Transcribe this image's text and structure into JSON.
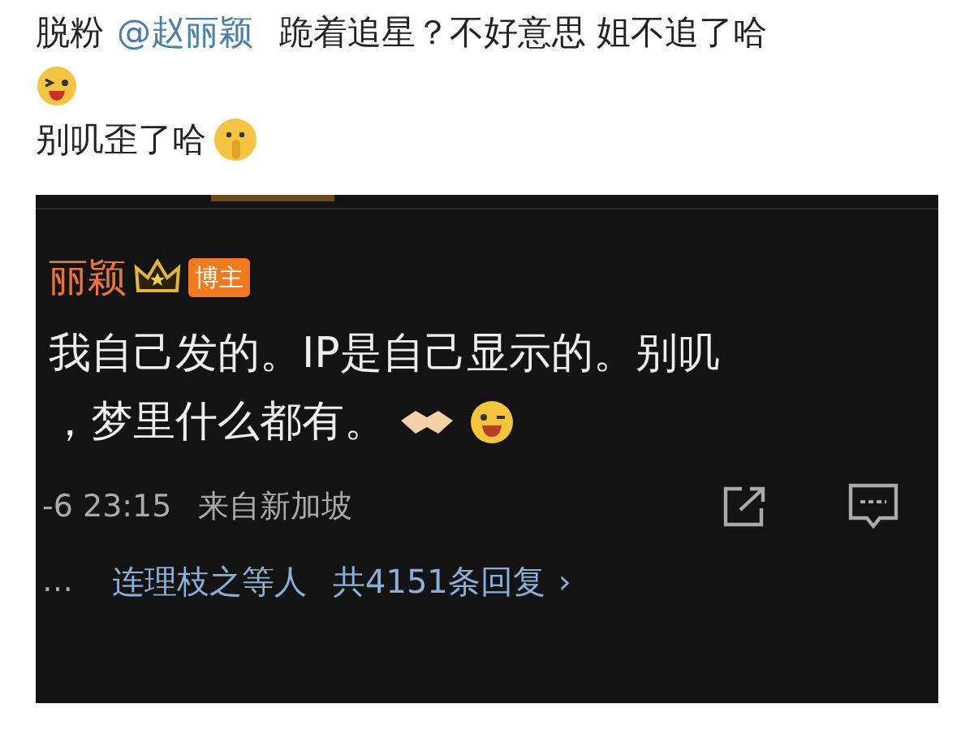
{
  "post": {
    "prefix": "脱粉",
    "mention": "@赵丽颖",
    "text": "跪着追星？不好意思 姐不追了哈",
    "line2": "别叽歪了哈"
  },
  "screenshot": {
    "author": "丽颖",
    "badge": "博主",
    "lines": [
      "我自己发的。IP是自己显示的。别叽",
      "，梦里什么都有。"
    ],
    "time": "-6 23:15",
    "source": "来自新加坡",
    "replies": {
      "more": "…",
      "names": "连理枝之等人",
      "count": "共4151条回复",
      "chevron": "›"
    }
  }
}
